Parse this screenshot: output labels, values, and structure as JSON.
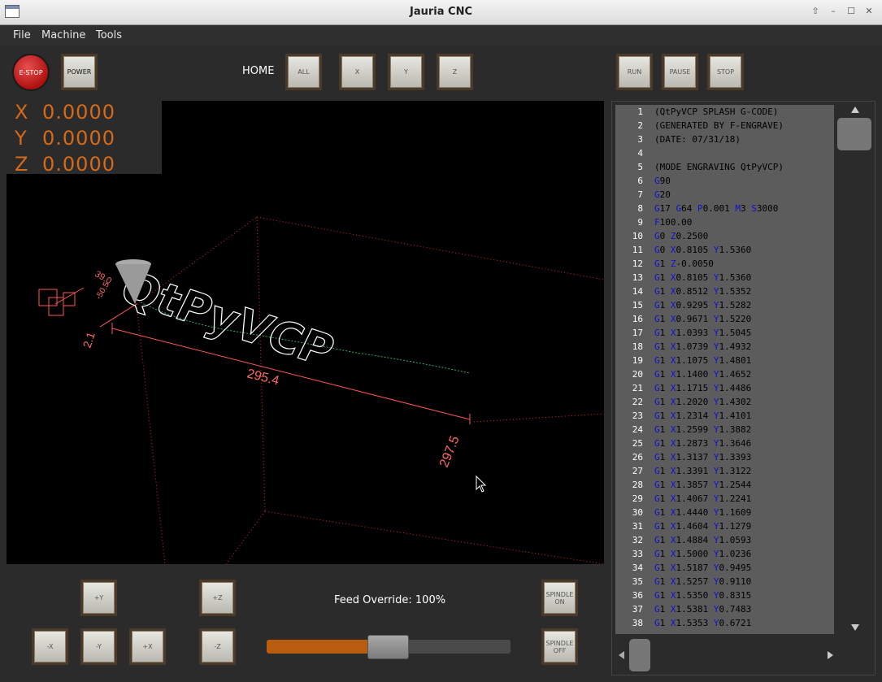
{
  "window": {
    "title": "Jauria CNC"
  },
  "menu": [
    "File",
    "Machine",
    "Tools"
  ],
  "toolbar": {
    "estop": "E-STOP",
    "power": "POWER",
    "home_label": "HOME",
    "home_all": "ALL",
    "home_x": "X",
    "home_y": "Y",
    "home_z": "Z",
    "run": "RUN",
    "pause": "PAUSE",
    "stop": "STOP"
  },
  "dro": [
    {
      "axis": "X",
      "value": "0.0000"
    },
    {
      "axis": "Y",
      "value": "0.0000"
    },
    {
      "axis": "Z",
      "value": "0.0000"
    }
  ],
  "viewport": {
    "dim_labels": [
      "295.4",
      "297.5",
      "2.1",
      "39.0",
      "-50.5"
    ],
    "engraved_text": "QtPyVCP"
  },
  "jog": {
    "plus_y": "+Y",
    "plus_z": "+Z",
    "minus_x": "-X",
    "minus_y": "-Y",
    "plus_x": "+X",
    "minus_z": "-Z"
  },
  "spindle": {
    "on": "SPINDLE ON",
    "off": "SPINDLE OFF"
  },
  "feed_override": {
    "label": "Feed Override: 100%",
    "value_percent": 100,
    "slider_fraction": 0.5
  },
  "gcode": [
    {
      "n": "1",
      "t": "(QtPyVCP SPLASH G-CODE)"
    },
    {
      "n": "2",
      "t": "(GENERATED BY F-ENGRAVE)"
    },
    {
      "n": "3",
      "t": "(DATE: 07/31/18)"
    },
    {
      "n": "4",
      "t": ""
    },
    {
      "n": "5",
      "t": "(MODE ENGRAVING QtPyVCP)"
    },
    {
      "n": "6",
      "t": "G90"
    },
    {
      "n": "7",
      "t": "G20"
    },
    {
      "n": "8",
      "t": "G17 G64 P0.001 M3 S3000"
    },
    {
      "n": "9",
      "t": "F100.00"
    },
    {
      "n": "10",
      "t": "G0 Z0.2500"
    },
    {
      "n": "11",
      "t": "G0 X0.8105 Y1.5360"
    },
    {
      "n": "12",
      "t": "G1 Z-0.0050"
    },
    {
      "n": "13",
      "t": "G1 X0.8105 Y1.5360"
    },
    {
      "n": "14",
      "t": "G1 X0.8512 Y1.5352"
    },
    {
      "n": "15",
      "t": "G1 X0.9295 Y1.5282"
    },
    {
      "n": "16",
      "t": "G1 X0.9671 Y1.5220"
    },
    {
      "n": "17",
      "t": "G1 X1.0393 Y1.5045"
    },
    {
      "n": "18",
      "t": "G1 X1.0739 Y1.4932"
    },
    {
      "n": "19",
      "t": "G1 X1.1075 Y1.4801"
    },
    {
      "n": "20",
      "t": "G1 X1.1400 Y1.4652"
    },
    {
      "n": "21",
      "t": "G1 X1.1715 Y1.4486"
    },
    {
      "n": "22",
      "t": "G1 X1.2020 Y1.4302"
    },
    {
      "n": "23",
      "t": "G1 X1.2314 Y1.4101"
    },
    {
      "n": "24",
      "t": "G1 X1.2599 Y1.3882"
    },
    {
      "n": "25",
      "t": "G1 X1.2873 Y1.3646"
    },
    {
      "n": "26",
      "t": "G1 X1.3137 Y1.3393"
    },
    {
      "n": "27",
      "t": "G1 X1.3391 Y1.3122"
    },
    {
      "n": "28",
      "t": "G1 X1.3857 Y1.2544"
    },
    {
      "n": "29",
      "t": "G1 X1.4067 Y1.2241"
    },
    {
      "n": "30",
      "t": "G1 X1.4440 Y1.1609"
    },
    {
      "n": "31",
      "t": "G1 X1.4604 Y1.1279"
    },
    {
      "n": "32",
      "t": "G1 X1.4884 Y1.0593"
    },
    {
      "n": "33",
      "t": "G1 X1.5000 Y1.0236"
    },
    {
      "n": "34",
      "t": "G1 X1.5187 Y0.9495"
    },
    {
      "n": "35",
      "t": "G1 X1.5257 Y0.9110"
    },
    {
      "n": "36",
      "t": "G1 X1.5350 Y0.8315"
    },
    {
      "n": "37",
      "t": "G1 X1.5381 Y0.7483"
    },
    {
      "n": "38",
      "t": "G1 X1.5353 Y0.6721"
    }
  ],
  "colors": {
    "dro": "#d56a18",
    "gcode_letter": "#1010d0",
    "gcode_comment_kw": "#c01010",
    "feed_fill": "#b85c10"
  }
}
